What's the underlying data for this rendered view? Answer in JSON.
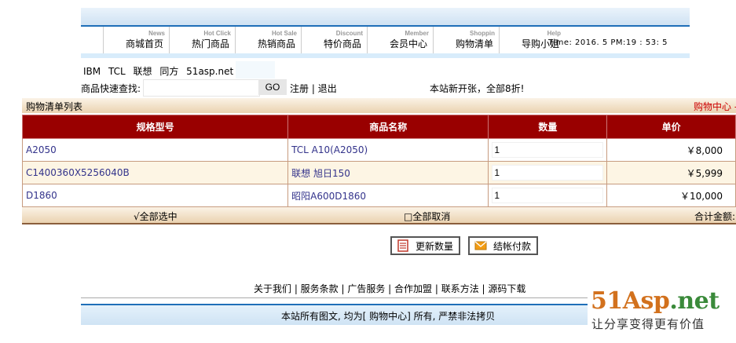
{
  "nav": {
    "items": [
      {
        "en": "News",
        "cn": "商城首页"
      },
      {
        "en": "Hot Click",
        "cn": "热门商品"
      },
      {
        "en": "Hot Sale",
        "cn": "热销商品"
      },
      {
        "en": "Discount",
        "cn": "特价商品"
      },
      {
        "en": "Member",
        "cn": "会员中心"
      },
      {
        "en": "Shoppin",
        "cn": "购物清单"
      },
      {
        "en": "Help",
        "cn": "导购小姐"
      }
    ],
    "time": "Time:  2016. 5 PM:19 :  53:  5"
  },
  "brands": [
    "IBM",
    "TCL",
    "联想",
    "同方",
    "51asp.net"
  ],
  "search": {
    "label": "商品快速查找:",
    "value": "",
    "go": "GO",
    "register": "注册",
    "sep": " | ",
    "logout": "退出",
    "notice": "本站新开张，全部8折!"
  },
  "list": {
    "title": "购物清单列表",
    "center": "购物中心 -"
  },
  "table": {
    "headers": [
      "规格型号",
      "商品名称",
      "数量",
      "单价"
    ],
    "rows": [
      {
        "model": "A2050",
        "name": "TCL A10(A2050)",
        "qty": "1",
        "price": "￥8,000"
      },
      {
        "model": "C1400360X5256040B",
        "name": "联想 旭日150",
        "qty": "1",
        "price": "￥5,999"
      },
      {
        "model": "D1860",
        "name": "昭阳A600D1860",
        "qty": "1",
        "price": "￥10,000"
      }
    ]
  },
  "bottom": {
    "select_all": "√全部选中",
    "deselect_all": "□全部取消",
    "total": "合计金额:"
  },
  "actions": {
    "update": "更新数量",
    "checkout": "结帐付款"
  },
  "footer": {
    "links": "关于我们 | 服务条款 | 广告服务 | 合作加盟 | 联系方法 | 源码下载",
    "copyright": "本站所有图文, 均为[ 购物中心] 所有, 严禁非法拷贝"
  },
  "watermark": {
    "logo_main": "51Asp",
    "logo_tail": ".net",
    "slogan": "让分享变得更有价值"
  },
  "colors": {
    "header_red": "#990000",
    "link_blue": "#33338b",
    "accent_blue": "#1f6fb8"
  }
}
